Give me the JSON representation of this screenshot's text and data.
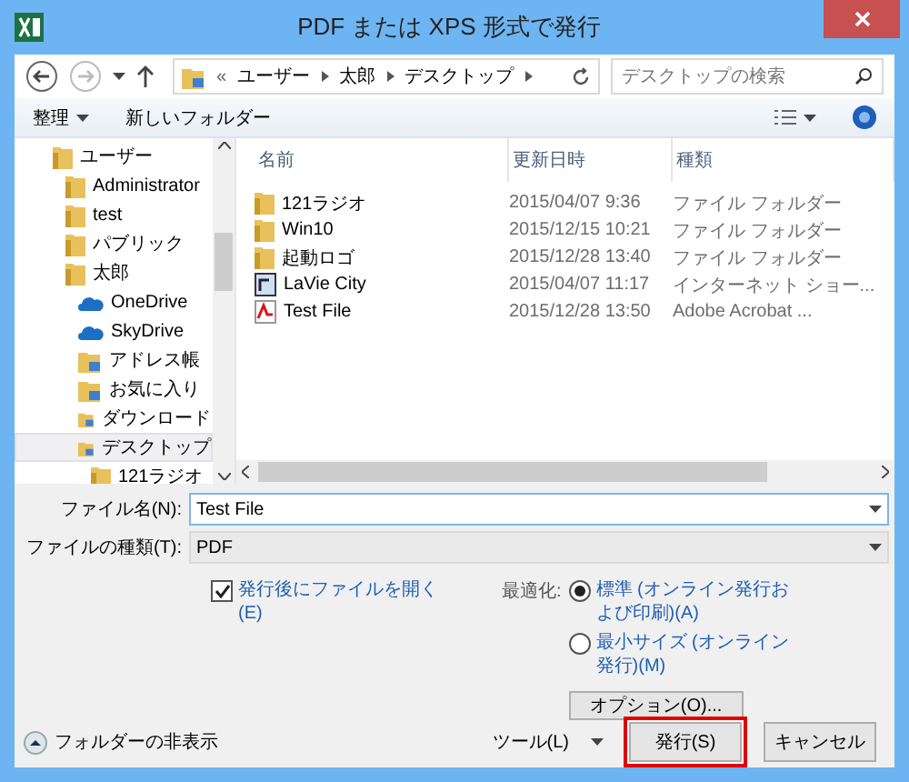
{
  "window": {
    "title": "PDF または XPS 形式で発行"
  },
  "address": {
    "prefix": "«",
    "crumbs": [
      "ユーザー",
      "太郎",
      "デスクトップ"
    ]
  },
  "search": {
    "placeholder": "デスクトップの検索"
  },
  "toolbar": {
    "organize": "整理",
    "new_folder": "新しいフォルダー"
  },
  "tree": [
    {
      "label": "ユーザー",
      "kind": "folder",
      "selected": false,
      "children": [
        {
          "label": "Administrator",
          "kind": "folder",
          "selected": false
        },
        {
          "label": "test",
          "kind": "folder",
          "selected": false
        },
        {
          "label": "パブリック",
          "kind": "folder",
          "selected": false
        },
        {
          "label": "太郎",
          "kind": "folder",
          "selected": false,
          "children": [
            {
              "label": "OneDrive",
              "kind": "cloud",
              "selected": false
            },
            {
              "label": "SkyDrive",
              "kind": "cloud",
              "selected": false
            },
            {
              "label": "アドレス帳",
              "kind": "special",
              "selected": false
            },
            {
              "label": "お気に入り",
              "kind": "special",
              "selected": false
            },
            {
              "label": "ダウンロード",
              "kind": "special",
              "selected": false
            },
            {
              "label": "デスクトップ",
              "kind": "special",
              "selected": true,
              "children": [
                {
                  "label": "121ラジオ",
                  "kind": "folder",
                  "selected": false
                }
              ]
            }
          ]
        }
      ]
    }
  ],
  "files": {
    "columns": [
      "名前",
      "更新日時",
      "種類"
    ],
    "rows": [
      {
        "name": "121ラジオ",
        "modified": "2015/04/07 9:36",
        "type": "ファイル フォルダー",
        "kind": "folder"
      },
      {
        "name": "Win10",
        "modified": "2015/12/15 10:21",
        "type": "ファイル フォルダー",
        "kind": "folder"
      },
      {
        "name": "起動ロゴ",
        "modified": "2015/12/28 13:40",
        "type": "ファイル フォルダー",
        "kind": "folder"
      },
      {
        "name": "LaVie City",
        "modified": "2015/04/07 11:17",
        "type": "インターネット ショー...",
        "kind": "shortcut"
      },
      {
        "name": "Test File",
        "modified": "2015/12/28 13:50",
        "type": "Adobe Acrobat ...",
        "kind": "pdf"
      }
    ]
  },
  "form": {
    "file_name": {
      "label": "ファイル名(N):",
      "value": "Test File"
    },
    "file_type": {
      "label": "ファイルの種類(T):",
      "value": "PDF"
    }
  },
  "open_after": {
    "label": "発行後にファイルを開く(E)",
    "checked": true
  },
  "optimize": {
    "label": "最適化:",
    "options": [
      {
        "label": "標準 (オンライン発行および印刷)(A)",
        "selected": true
      },
      {
        "label": "最小サイズ (オンライン発行)(M)",
        "selected": false
      }
    ]
  },
  "options_button": "オプション(O)...",
  "hide_folders": "フォルダーの非表示",
  "tools": "ツール(L)",
  "publish": {
    "label": "発行(S)",
    "highlighted": true
  },
  "cancel": "キャンセル"
}
